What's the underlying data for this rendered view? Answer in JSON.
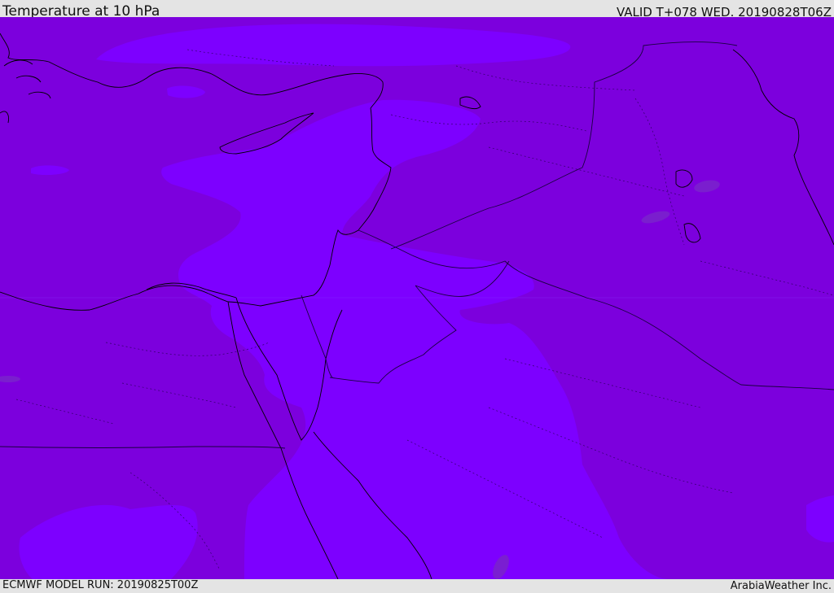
{
  "header": {
    "title": "Temperature at 10 hPa",
    "valid": "VALID T+078 WED. 20190828T06Z"
  },
  "footer": {
    "model_run": "ECMWF MODEL RUN: 20190825T00Z",
    "credit": "ArabiaWeather Inc."
  },
  "map": {
    "colors": {
      "background_fill": "#7c00dd",
      "warm_patch_fill": "#7d00ff",
      "cold_spot_fill": "#7a22cc",
      "coastline": "#000000",
      "borders": "#1a0040"
    }
  }
}
